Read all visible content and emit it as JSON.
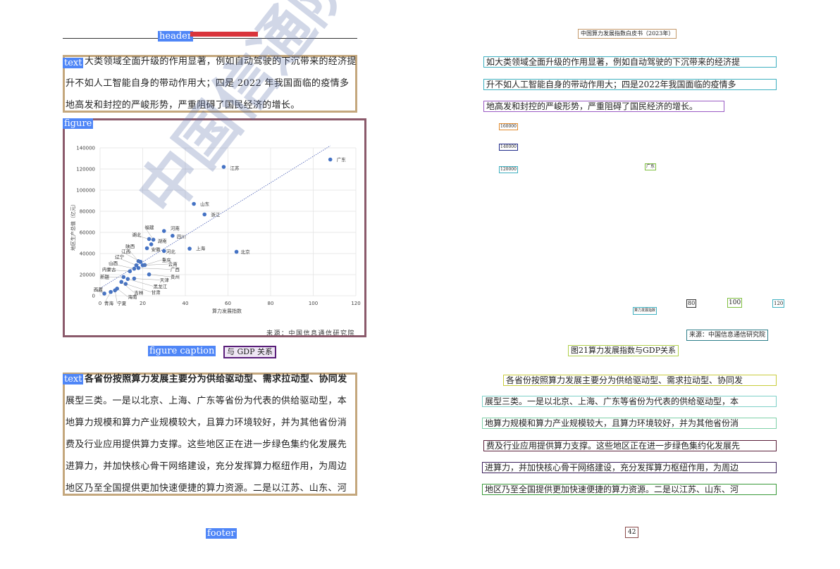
{
  "labels": {
    "header": "header",
    "text": "text",
    "figure": "figure",
    "figure_caption": "figure caption",
    "footer": "footer"
  },
  "left": {
    "caption_tail": "与 GDP 关系",
    "para1": [
      "大类领域全面升级的作用显著，例如自动驾驶的下沉带来的经济提",
      "升不如人工智能自身的带动作用大；四是 2022 年我国面临的疫情多",
      "地高发和封控的严峻形势，严重阻碍了国民经济的增长。"
    ],
    "para2": [
      "各省份按照算力发展主要分为供给驱动型、需求拉动型、协同发",
      "展型三类。一是以北京、上海、广东等省份为代表的供给驱动型，本",
      "地算力规模和算力产业规模较大，且算力环境较好，并为其他省份消",
      "费及行业应用提供算力支撑。这些地区正在进一步绿色集约化发展先",
      "进算力，并加快核心骨干网络建设，充分发挥算力枢纽作用，为周边",
      "地区乃至全国提供更加快速便捷的算力资源。二是以江苏、山东、河"
    ],
    "source": "来源：中国信息通信研究院",
    "watermark": "中国信通院"
  },
  "right": {
    "header": "中国算力发展指数白皮书（2023年）",
    "para1": [
      "如大类领域全面升级的作用显著，例如自动驾驶的下沉带来的经济提",
      "升不如人工智能自身的带动作用大；四是2022年我国面临的疫情多",
      "地高发和封控的严峻形势，严重阻碍了国民经济的增长。"
    ],
    "ticks": [
      "160000",
      "140000",
      "120000",
      "广东",
      "80",
      "100",
      "120",
      "算力发展指数"
    ],
    "source": "来源：中国信息通信研究院",
    "caption": "图21算力发展指数与GDP关系",
    "para2": [
      "各省份按照算力发展主要分为供给驱动型、需求拉动型、协同发",
      "展型三类。一是以北京、上海、广东等省份为代表的供给驱动型，本",
      "地算力规模和算力产业规模较大，且算力环境较好，并为其他省份消",
      "费及行业应用提供算力支撑。这些地区正在进一步绿色集约化发展先",
      "进算力，并加快核心骨干网络建设，充分发挥算力枢纽作用，为周边",
      "地区乃至全国提供更加快速便捷的算力资源。二是以江苏、山东、河"
    ],
    "page_number": "42"
  },
  "chart_data": {
    "type": "scatter",
    "xlabel": "算力发展指数",
    "ylabel": "地区生产总值（亿元）",
    "xlim": [
      0,
      120
    ],
    "ylim": [
      0,
      140000
    ],
    "xticks": [
      "0",
      "20",
      "40",
      "60",
      "80",
      "100",
      "120"
    ],
    "yticks": [
      "0",
      "20000",
      "40000",
      "60000",
      "80000",
      "100000",
      "120000",
      "140000"
    ],
    "trendline": [
      [
        0,
        7000
      ],
      [
        108,
        142000
      ]
    ],
    "points": [
      {
        "name": "广东",
        "x": 108,
        "y": 129000,
        "lx": 111,
        "ly": 129000
      },
      {
        "name": "江苏",
        "x": 58,
        "y": 122000,
        "lx": 61,
        "ly": 121000
      },
      {
        "name": "山东",
        "x": 44,
        "y": 87000,
        "lx": 47,
        "ly": 87000
      },
      {
        "name": "浙江",
        "x": 49,
        "y": 77000,
        "lx": 52,
        "ly": 77000
      },
      {
        "name": "北京",
        "x": 64,
        "y": 41600,
        "lx": 66,
        "ly": 41600
      },
      {
        "name": "上海",
        "x": 42,
        "y": 44600,
        "lx": 45,
        "ly": 45000
      },
      {
        "name": "河南",
        "x": 30,
        "y": 61300,
        "lx": 33,
        "ly": 64000
      },
      {
        "name": "福建",
        "x": 25,
        "y": 53100,
        "lx": 21,
        "ly": 65000
      },
      {
        "name": "四川",
        "x": 34,
        "y": 56800,
        "lx": 36,
        "ly": 56000
      },
      {
        "name": "湖北",
        "x": 23,
        "y": 53700,
        "lx": 15,
        "ly": 58000
      },
      {
        "name": "湖南",
        "x": 24,
        "y": 48700,
        "lx": 27,
        "ly": 52000
      },
      {
        "name": "安徽",
        "x": 22,
        "y": 45000,
        "lx": 24,
        "ly": 44000
      },
      {
        "name": "河北",
        "x": 30,
        "y": 42400,
        "lx": 31,
        "ly": 42000
      },
      {
        "name": "陕西",
        "x": 18,
        "y": 32800,
        "lx": 12,
        "ly": 47000
      },
      {
        "name": "江西",
        "x": 19,
        "y": 32100,
        "lx": 10,
        "ly": 42000
      },
      {
        "name": "辽宁",
        "x": 17,
        "y": 28900,
        "lx": 7,
        "ly": 37000
      },
      {
        "name": "重庆",
        "x": 21,
        "y": 29100,
        "lx": 29,
        "ly": 34000
      },
      {
        "name": "云南",
        "x": 20,
        "y": 28900,
        "lx": 32,
        "ly": 30000
      },
      {
        "name": "广西",
        "x": 18,
        "y": 26300,
        "lx": 33,
        "ly": 25000
      },
      {
        "name": "山西",
        "x": 16,
        "y": 25600,
        "lx": 4,
        "ly": 31000
      },
      {
        "name": "内蒙古",
        "x": 14,
        "y": 23200,
        "lx": 1,
        "ly": 25000
      },
      {
        "name": "贵州",
        "x": 23,
        "y": 20200,
        "lx": 33,
        "ly": 18000
      },
      {
        "name": "新疆",
        "x": 11,
        "y": 17700,
        "lx": 0,
        "ly": 18000
      },
      {
        "name": "天津",
        "x": 16,
        "y": 16300,
        "lx": 28,
        "ly": 15000
      },
      {
        "name": "黑龙江",
        "x": 13,
        "y": 15900,
        "lx": 25,
        "ly": 9000
      },
      {
        "name": "吉林",
        "x": 10,
        "y": 13100,
        "lx": 16,
        "ly": 3000
      },
      {
        "name": "甘肃",
        "x": 12,
        "y": 11200,
        "lx": 24,
        "ly": 3500
      },
      {
        "name": "海南",
        "x": 8,
        "y": 6800,
        "lx": 13,
        "ly": -1000
      },
      {
        "name": "宁夏",
        "x": 7,
        "y": 5100,
        "lx": 8,
        "ly": -7000
      },
      {
        "name": "西藏",
        "x": 2,
        "y": 2100,
        "lx": -3,
        "ly": 6000
      },
      {
        "name": "青海",
        "x": 5,
        "y": 3600,
        "lx": 2,
        "ly": -7000
      }
    ]
  }
}
